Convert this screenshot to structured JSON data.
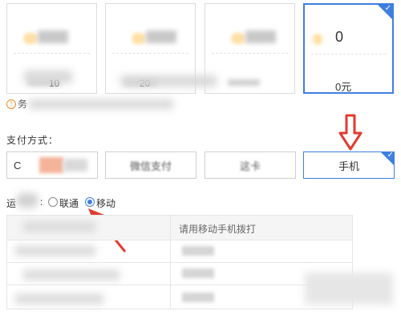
{
  "top_cards": [
    {
      "amount_fragment": "",
      "price_fragment": "10"
    },
    {
      "amount_fragment": "",
      "price_fragment": "20"
    },
    {
      "amount_fragment": "",
      "price_fragment": ""
    },
    {
      "amount_fragment": "0",
      "price_fragment": "0元",
      "selected": true
    }
  ],
  "notice": {
    "icon": "info-icon",
    "visible_char": "务"
  },
  "payment": {
    "section_label": "支付方式：",
    "options": [
      {
        "label": "C"
      },
      {
        "label": "微信支付"
      },
      {
        "label": "这卡"
      },
      {
        "label": "手机",
        "selected": true
      }
    ]
  },
  "carrier": {
    "label_fragment": "运",
    "options": [
      {
        "label": "联通",
        "checked": false
      },
      {
        "label": "移动",
        "checked": true
      }
    ]
  },
  "table": {
    "col2_header": "请用移动手机拨打"
  },
  "colors": {
    "accent": "#3e7fe0",
    "annotation_red": "#e23b30",
    "notice_orange": "#f08a24"
  }
}
